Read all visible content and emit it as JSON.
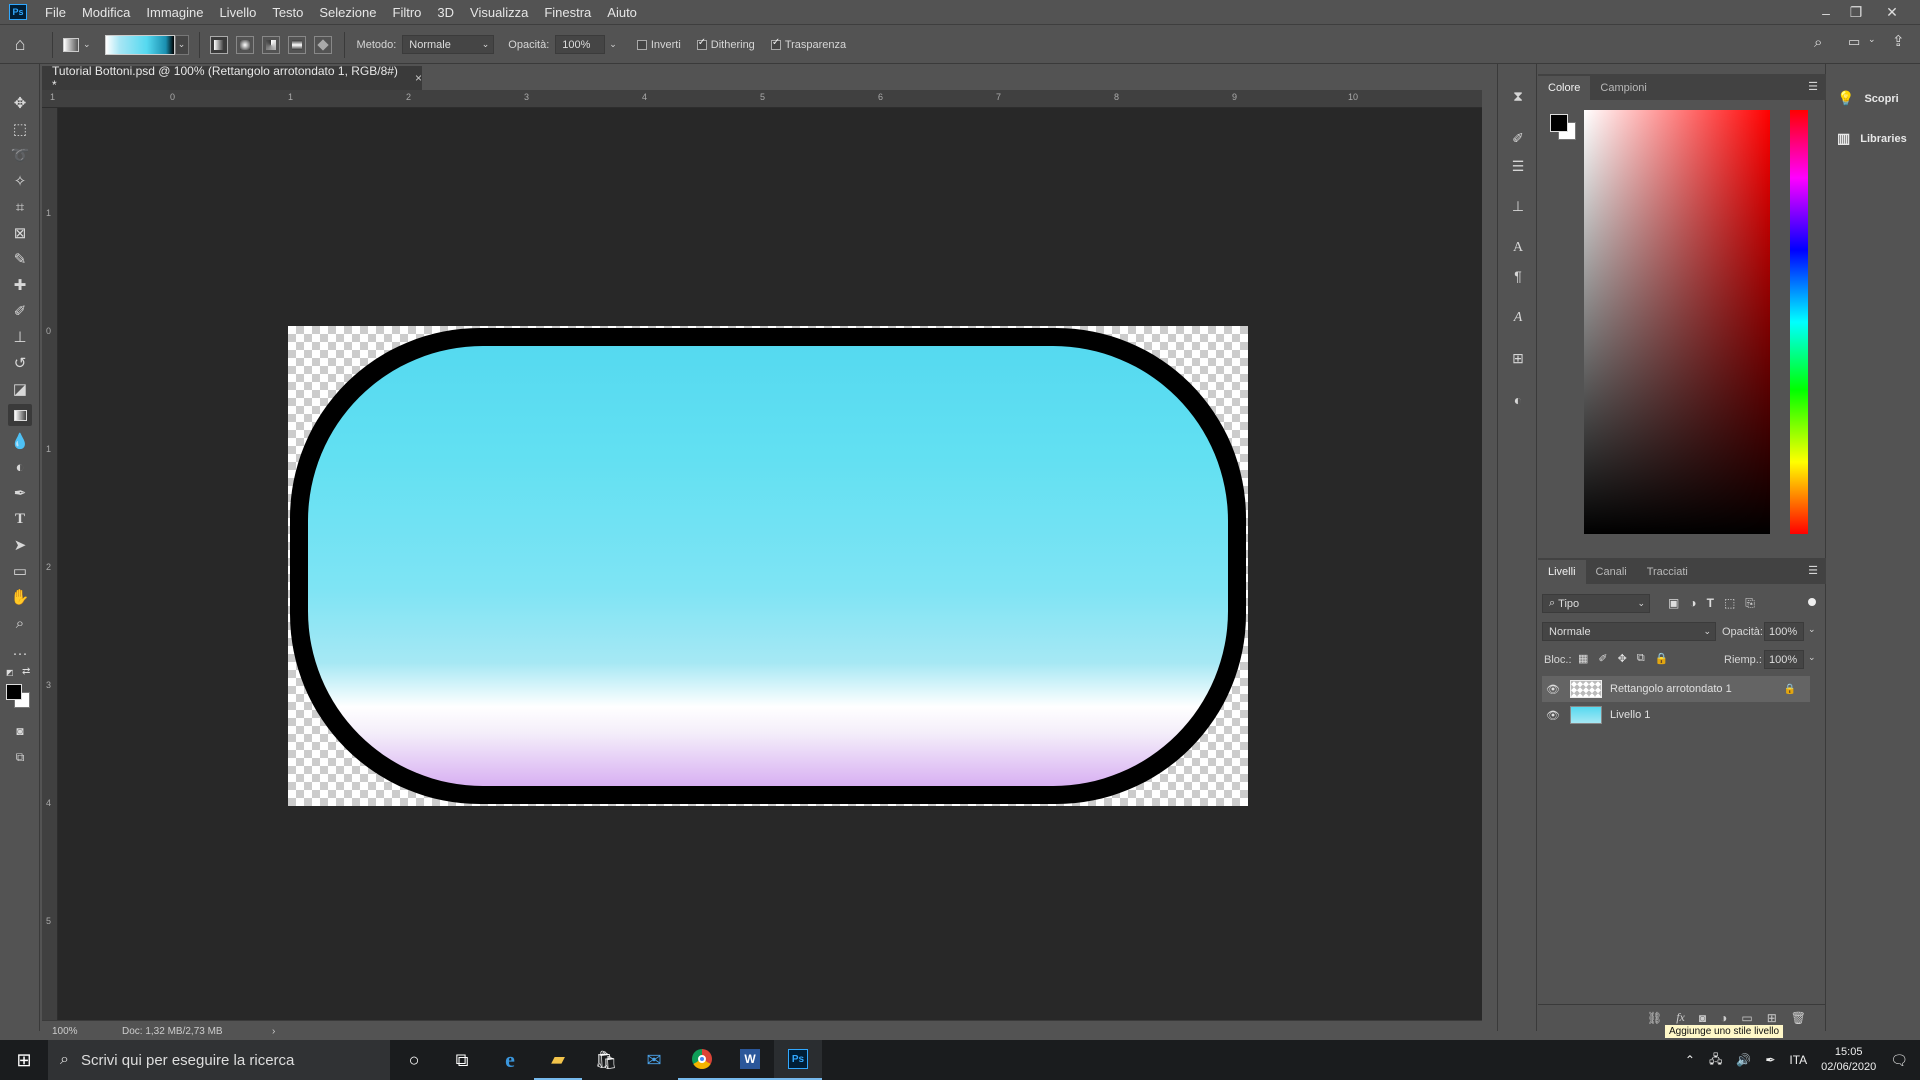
{
  "menubar": {
    "logo": "Ps",
    "items": [
      "File",
      "Modifica",
      "Immagine",
      "Livello",
      "Testo",
      "Selezione",
      "Filtro",
      "3D",
      "Visualizza",
      "Finestra",
      "Aiuto"
    ]
  },
  "options": {
    "method_label": "Metodo:",
    "method_value": "Normale",
    "opacity_label": "Opacità:",
    "opacity_value": "100%",
    "invert_label": "Inverti",
    "invert_checked": false,
    "dithering_label": "Dithering",
    "dithering_checked": true,
    "transparency_label": "Trasparenza",
    "transparency_checked": true
  },
  "document": {
    "tab_title": "Tutorial Bottoni.psd @ 100% (Rettangolo arrotondato 1, RGB/8#) *",
    "close": "×",
    "ruler_h": [
      "1",
      "0",
      "1",
      "2",
      "3",
      "4",
      "5",
      "6",
      "7",
      "8",
      "9",
      "10"
    ],
    "ruler_v": [
      "1",
      "0",
      "1",
      "2",
      "3",
      "4",
      "5"
    ]
  },
  "status": {
    "zoom": "100%",
    "doc_info": "Doc: 1,32 MB/2,73 MB",
    "arrow": "›"
  },
  "color_panel": {
    "tabs": [
      "Colore",
      "Campioni"
    ],
    "foreground": "#000000",
    "background": "#ffffff"
  },
  "layers_panel": {
    "tabs": [
      "Livelli",
      "Canali",
      "Tracciati"
    ],
    "filter_value": "Tipo",
    "blend_mode": "Normale",
    "opacity_label": "Opacità:",
    "opacity_value": "100%",
    "lock_label": "Bloc.:",
    "fill_label": "Riemp.:",
    "fill_value": "100%",
    "layers": [
      {
        "name": "Rettangolo arrotondato 1",
        "visible": true,
        "selected": true,
        "locked": true
      },
      {
        "name": "Livello 1",
        "visible": true,
        "selected": false,
        "locked": false
      }
    ],
    "tooltip": "Aggiunge uno stile livello",
    "fx": "fx"
  },
  "side_panel": {
    "items": [
      "Scopri",
      "Libraries"
    ]
  },
  "taskbar": {
    "search_placeholder": "Scrivi qui per eseguire la ricerca",
    "language": "ITA",
    "time": "15:05",
    "date": "02/06/2020"
  }
}
